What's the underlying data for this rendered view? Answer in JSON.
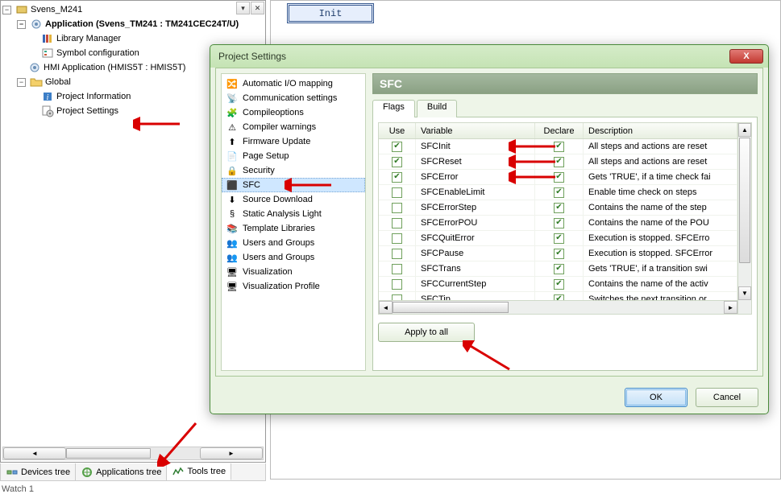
{
  "tree": {
    "root": "Svens_M241",
    "app": "Application (Svens_TM241 : TM241CEC24T/U)",
    "lib": "Library Manager",
    "sym": "Symbol configuration",
    "hmi": "HMI Application (HMIS5T : HMIS5T)",
    "global": "Global",
    "pinfo": "Project Information",
    "pset": "Project Settings"
  },
  "tabs_bottom": {
    "devices": "Devices tree",
    "apps": "Applications tree",
    "tools": "Tools tree"
  },
  "canvas": {
    "init": "Init"
  },
  "dialog": {
    "title": "Project Settings",
    "close_x": "X",
    "section": "SFC",
    "tabs": {
      "flags": "Flags",
      "build": "Build"
    },
    "categories": [
      "Automatic I/O mapping",
      "Communication settings",
      "Compileoptions",
      "Compiler warnings",
      "Firmware Update",
      "Page Setup",
      "Security",
      "SFC",
      "Source Download",
      "Static Analysis Light",
      "Template Libraries",
      "Users and Groups",
      "Users and Groups",
      "Visualization",
      "Visualization Profile"
    ],
    "cat_selected_index": 7,
    "grid": {
      "headers": {
        "use": "Use",
        "var": "Variable",
        "dec": "Declare",
        "desc": "Description"
      },
      "rows": [
        {
          "use": true,
          "var": "SFCInit",
          "dec": true,
          "desc": "All steps and actions are reset"
        },
        {
          "use": true,
          "var": "SFCReset",
          "dec": true,
          "desc": "All steps and actions are reset"
        },
        {
          "use": true,
          "var": "SFCError",
          "dec": true,
          "desc": "Gets 'TRUE', if a time check fai"
        },
        {
          "use": false,
          "var": "SFCEnableLimit",
          "dec": true,
          "desc": "Enable time check on steps"
        },
        {
          "use": false,
          "var": "SFCErrorStep",
          "dec": true,
          "desc": "Contains the name of the step"
        },
        {
          "use": false,
          "var": "SFCErrorPOU",
          "dec": true,
          "desc": "Contains the name of the POU"
        },
        {
          "use": false,
          "var": "SFCQuitError",
          "dec": true,
          "desc": "Execution is stopped. SFCErro"
        },
        {
          "use": false,
          "var": "SFCPause",
          "dec": true,
          "desc": "Execution is stopped. SFCError"
        },
        {
          "use": false,
          "var": "SFCTrans",
          "dec": true,
          "desc": "Gets 'TRUE', if a transition swi"
        },
        {
          "use": false,
          "var": "SFCCurrentStep",
          "dec": true,
          "desc": "Contains the name of the activ"
        },
        {
          "use": false,
          "var": "SFCTip",
          "dec": true,
          "desc": "Switches the next transition or"
        }
      ]
    },
    "apply": "Apply to all",
    "ok": "OK",
    "cancel": "Cancel"
  },
  "status": "Watch 1"
}
